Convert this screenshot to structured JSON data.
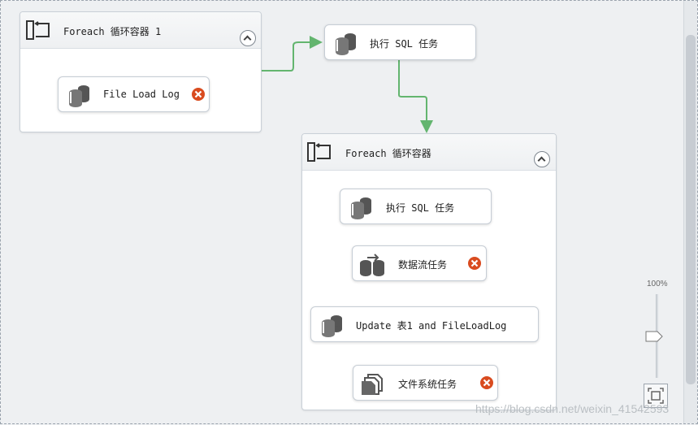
{
  "containers": [
    {
      "title": "Foreach 循环容器 1"
    },
    {
      "title": "Foreach 循环容器"
    }
  ],
  "tasks": [
    {
      "label": "File Load Log",
      "status": "error",
      "icon": "sql-task-icon"
    },
    {
      "label": "执行 SQL 任务",
      "status": "normal",
      "icon": "sql-task-icon"
    },
    {
      "label": "执行 SQL 任务",
      "status": "normal",
      "icon": "sql-task-icon"
    },
    {
      "label": "数据流任务",
      "status": "error",
      "icon": "data-flow-icon"
    },
    {
      "label": "Update 表1 and FileLoadLog",
      "status": "normal",
      "icon": "sql-task-icon"
    },
    {
      "label": "文件系统任务",
      "status": "error",
      "icon": "file-system-icon"
    }
  ],
  "zoom": {
    "level": "100%"
  },
  "watermark": "https://blog.csdn.net/weixin_41542593",
  "colors": {
    "connector": "#63b56f",
    "error": "#d94b1f"
  }
}
